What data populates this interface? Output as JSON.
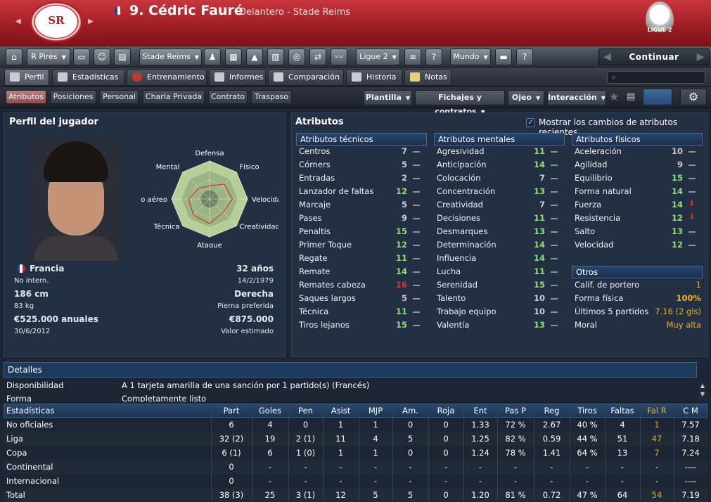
{
  "header": {
    "player_title": "9. Cédric Fauré",
    "player_sub": "Delantero - Stade Reims",
    "club_abbr": "SR",
    "league_logo_text": "LIGUE 2"
  },
  "toolbar": {
    "manager_menu": "R Pirès",
    "club_menu": "Stade Reims",
    "league_menu": "Ligue 2",
    "world_menu": "Mundo",
    "continue_label": "Continuar"
  },
  "tabs": [
    "Perfil",
    "Estadísticas",
    "Entrenamiento",
    "Informes",
    "Comparación",
    "Historia",
    "Notas"
  ],
  "subnav": {
    "items": [
      "Atributos",
      "Posiciones",
      "Personal",
      "Charla Privada",
      "Contrato",
      "Traspaso"
    ],
    "dropdowns": [
      "Plantilla",
      "Fichajes y contratos",
      "Ojeo",
      "Interacción"
    ]
  },
  "profile": {
    "title": "Perfil del jugador",
    "nationality": "Francia",
    "intl": "No intern.",
    "height": "186 cm",
    "weight": "83 kg",
    "wage": "€525.000 anuales",
    "contract_end": "30/6/2012",
    "age": "32 años",
    "dob": "14/2/1979",
    "foot": "Derecha",
    "foot_label": "Pierna preferida",
    "value": "€875.000",
    "value_label": "Valor estimado"
  },
  "radar": {
    "labels": [
      "Defensa",
      "Físico",
      "Velocida",
      "Creatividad",
      "Ataque",
      "Técnica",
      "go aéreo",
      "Mental"
    ],
    "values": [
      0.35,
      0.55,
      0.6,
      0.5,
      0.65,
      0.6,
      0.55,
      0.4
    ]
  },
  "attributes": {
    "title": "Atributos",
    "show_recent_label": "Mostrar los cambios de atributos recientes",
    "technical_title": "Atributos técnicos",
    "mental_title": "Atributos mentales",
    "physical_title": "Atributos físicos",
    "other_title": "Otros",
    "technical": [
      {
        "n": "Centros",
        "v": "7",
        "t": "flat"
      },
      {
        "n": "Córners",
        "v": "5",
        "t": "flat"
      },
      {
        "n": "Entradas",
        "v": "2",
        "t": "flat"
      },
      {
        "n": "Lanzador de faltas",
        "v": "12",
        "t": "flat"
      },
      {
        "n": "Marcaje",
        "v": "5",
        "t": "flat"
      },
      {
        "n": "Pases",
        "v": "9",
        "t": "flat"
      },
      {
        "n": "Penaltis",
        "v": "15",
        "t": "flat"
      },
      {
        "n": "Primer Toque",
        "v": "12",
        "t": "flat"
      },
      {
        "n": "Regate",
        "v": "11",
        "t": "flat"
      },
      {
        "n": "Remate",
        "v": "14",
        "t": "flat"
      },
      {
        "n": "Remates cabeza",
        "v": "16",
        "t": "flat"
      },
      {
        "n": "Saques largos",
        "v": "5",
        "t": "flat"
      },
      {
        "n": "Técnica",
        "v": "11",
        "t": "flat"
      },
      {
        "n": "Tiros lejanos",
        "v": "15",
        "t": "flat"
      }
    ],
    "mental": [
      {
        "n": "Agresividad",
        "v": "11",
        "t": "flat"
      },
      {
        "n": "Anticipación",
        "v": "14",
        "t": "flat"
      },
      {
        "n": "Colocación",
        "v": "7",
        "t": "flat"
      },
      {
        "n": "Concentración",
        "v": "13",
        "t": "flat"
      },
      {
        "n": "Creatividad",
        "v": "7",
        "t": "flat"
      },
      {
        "n": "Decisiones",
        "v": "11",
        "t": "flat"
      },
      {
        "n": "Desmarques",
        "v": "13",
        "t": "flat"
      },
      {
        "n": "Determinación",
        "v": "14",
        "t": "flat"
      },
      {
        "n": "Influencia",
        "v": "14",
        "t": "flat"
      },
      {
        "n": "Lucha",
        "v": "11",
        "t": "flat"
      },
      {
        "n": "Serenidad",
        "v": "15",
        "t": "flat"
      },
      {
        "n": "Talento",
        "v": "10",
        "t": "flat"
      },
      {
        "n": "Trabajo equipo",
        "v": "10",
        "t": "flat"
      },
      {
        "n": "Valentía",
        "v": "13",
        "t": "flat"
      }
    ],
    "physical": [
      {
        "n": "Aceleración",
        "v": "10",
        "t": "flat"
      },
      {
        "n": "Agilidad",
        "v": "9",
        "t": "flat"
      },
      {
        "n": "Equilibrio",
        "v": "15",
        "t": "flat"
      },
      {
        "n": "Forma natural",
        "v": "14",
        "t": "flat"
      },
      {
        "n": "Fuerza",
        "v": "14",
        "t": "down"
      },
      {
        "n": "Resistencia",
        "v": "12",
        "t": "down"
      },
      {
        "n": "Salto",
        "v": "13",
        "t": "flat"
      },
      {
        "n": "Velocidad",
        "v": "12",
        "t": "flat"
      }
    ],
    "other": [
      {
        "n": "Calif. de portero",
        "v": "1"
      },
      {
        "n": "Forma física",
        "v": "100%"
      },
      {
        "n": "Últimos 5 partidos",
        "v": "7.16 (2 gls)"
      },
      {
        "n": "Moral",
        "v": "Muy alta"
      }
    ]
  },
  "details": {
    "title": "Detalles",
    "rows": [
      {
        "k": "Disponibilidad",
        "v": "A 1 tarjeta amarilla de una sanción por 1 partido(s) (Francés)"
      },
      {
        "k": "Forma",
        "v": "Completamente listo"
      }
    ]
  },
  "stats": {
    "headers": [
      "Estadísticas",
      "Part",
      "Goles",
      "Pen",
      "Asist",
      "MJP",
      "Am.",
      "Roja",
      "Ent",
      "Pas P",
      "Reg",
      "Tiros",
      "Faltas",
      "Fal R",
      "C M"
    ],
    "rows": [
      [
        "No oficiales",
        "6",
        "4",
        "0",
        "1",
        "1",
        "0",
        "0",
        "1.33",
        "72 %",
        "2.67",
        "40 %",
        "4",
        "1",
        "7.57"
      ],
      [
        "Liga",
        "32 (2)",
        "19",
        "2 (1)",
        "11",
        "4",
        "5",
        "0",
        "1.25",
        "82 %",
        "0.59",
        "44 %",
        "51",
        "47",
        "7.18"
      ],
      [
        "Copa",
        "6 (1)",
        "6",
        "1 (0)",
        "1",
        "1",
        "0",
        "0",
        "1.24",
        "78 %",
        "1.41",
        "64 %",
        "13",
        "7",
        "7.24"
      ],
      [
        "Continental",
        "0",
        "-",
        "-",
        "-",
        "-",
        "-",
        "-",
        "-",
        "-",
        "-",
        "-",
        "-",
        "-",
        "----"
      ],
      [
        "Internacional",
        "0",
        "-",
        "-",
        "-",
        "-",
        "-",
        "-",
        "-",
        "-",
        "-",
        "-",
        "-",
        "-",
        "----"
      ],
      [
        "Total",
        "38 (3)",
        "25",
        "3 (1)",
        "12",
        "5",
        "5",
        "0",
        "1.20",
        "81 %",
        "0.72",
        "47 %",
        "64",
        "54",
        "7.19"
      ]
    ]
  }
}
